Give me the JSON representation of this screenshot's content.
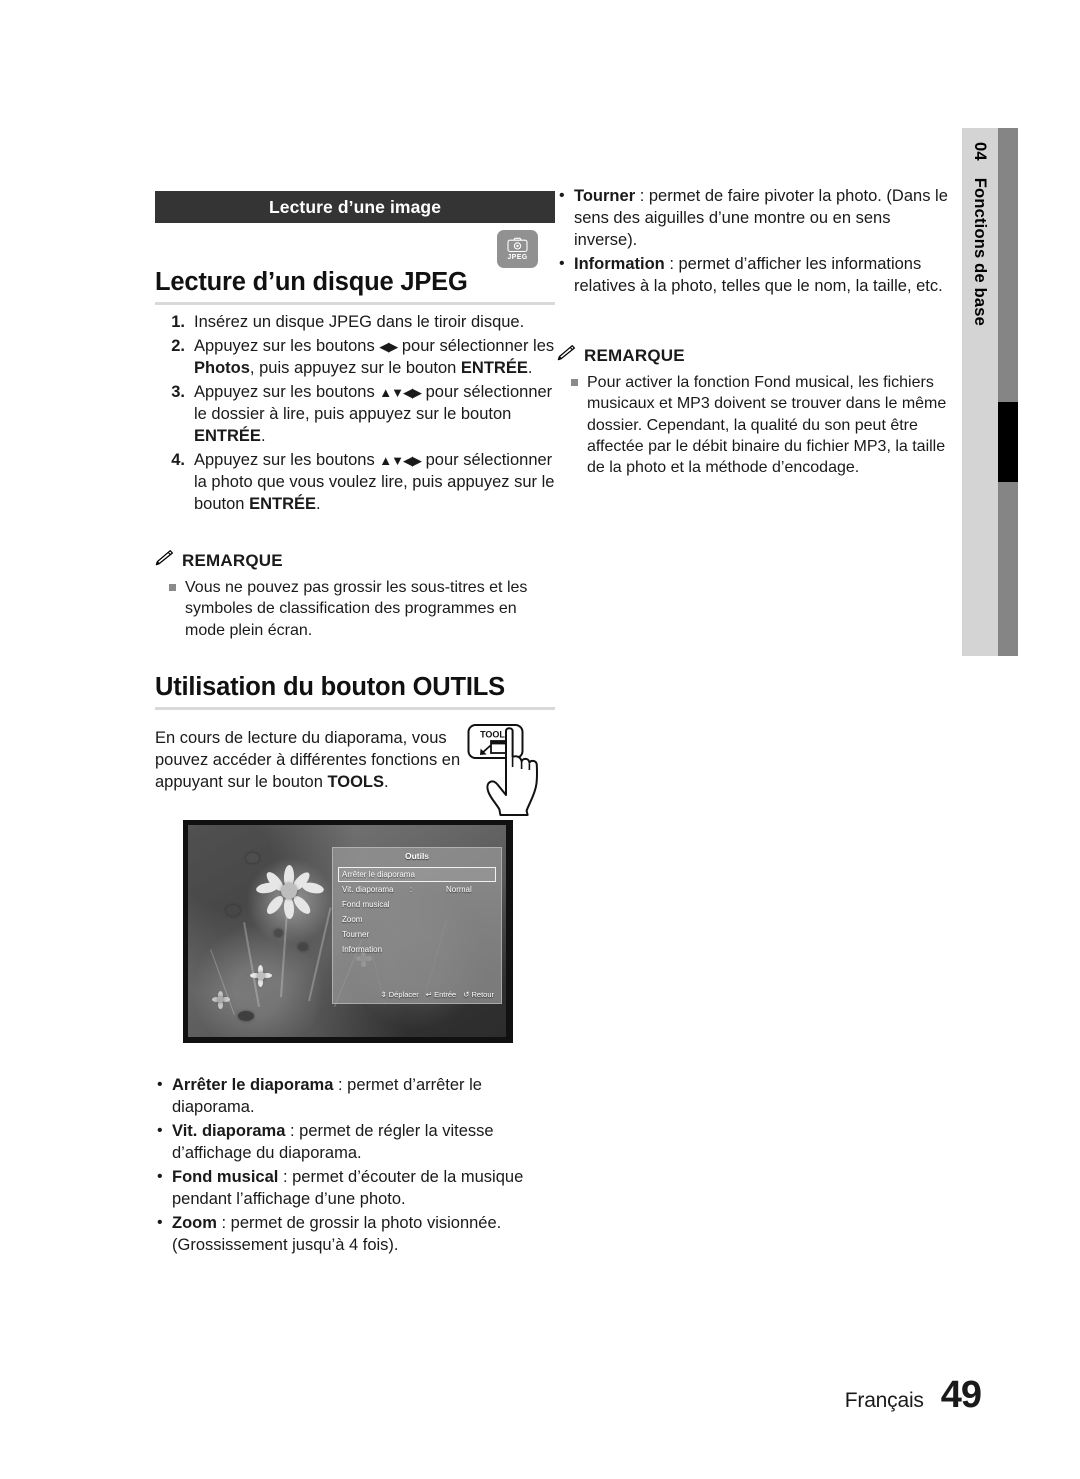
{
  "sidebar": {
    "chapter_number": "04",
    "chapter_title": "Fonctions de base"
  },
  "section_bar": {
    "label": "Lecture d’une image"
  },
  "media_badge": {
    "icon": "camera-icon",
    "label": "JPEG"
  },
  "jpeg_section": {
    "heading": "Lecture d’un disque JPEG",
    "steps": [
      {
        "num": "1.",
        "html": "Insérez un disque JPEG dans le tiroir disque."
      },
      {
        "num": "2.",
        "html": "Appuyez sur les boutons <span class=\"arr\">◀▶</span> pour sélectionner les <b>Photos</b>, puis appuyez sur le bouton <b>ENTRÉE</b>."
      },
      {
        "num": "3.",
        "html": "Appuyez sur les boutons <span class=\"arr\">▲▼◀▶</span> pour sélectionner le dossier à lire, puis appuyez sur le bouton <b>ENTRÉE</b>."
      },
      {
        "num": "4.",
        "html": "Appuyez sur les boutons <span class=\"arr\">▲▼◀▶</span> pour sélectionner la photo que vous voulez lire, puis appuyez sur le bouton <b>ENTRÉE</b>."
      }
    ],
    "note_title": "REMARQUE",
    "notes": [
      "Vous ne pouvez pas grossir les sous-titres et les symboles de classification des programmes en mode plein écran."
    ]
  },
  "tools_section": {
    "heading": "Utilisation du bouton OUTILS",
    "paragraph_html": "En cours de lecture du diaporama, vous pouvez accéder à différentes fonctions en appuyant sur le bouton <b>TOOLS</b>.",
    "button_label": "TOOLS"
  },
  "osd": {
    "title": "Outils",
    "items": [
      {
        "label": "Arrêter le diaporama",
        "separator": "",
        "value": "",
        "selected": true
      },
      {
        "label": "Vit. diaporama",
        "separator": ":",
        "value": "Normal",
        "selected": false
      },
      {
        "label": "Fond musical",
        "separator": "",
        "value": "",
        "selected": false
      },
      {
        "label": "Zoom",
        "separator": "",
        "value": "",
        "selected": false
      },
      {
        "label": "Tourner",
        "separator": "",
        "value": "",
        "selected": false
      },
      {
        "label": "Information",
        "separator": "",
        "value": "",
        "selected": false
      }
    ],
    "footer": [
      {
        "icon": "up-down-arrow-icon",
        "label": "Déplacer"
      },
      {
        "icon": "enter-icon",
        "label": "Entrée"
      },
      {
        "icon": "return-icon",
        "label": "Retour"
      }
    ]
  },
  "features_left": [
    "<b>Arrêter le diaporama</b> : permet d’arrêter le diaporama.",
    "<b>Vit. diaporama</b> : permet de régler la vitesse d’affichage du diaporama.",
    "<b>Fond musical</b> : permet d’écouter de la musique pendant l’affichage d’une photo.",
    "<b>Zoom</b> : permet de grossir la photo visionnée. (Grossissement jusqu’à 4 fois)."
  ],
  "features_right": [
    "<b>Tourner</b> : permet de faire pivoter la photo. (Dans le sens des aiguilles d’une montre ou en sens inverse).",
    "<b>Information</b> : permet d’afficher les informations relatives à la photo, telles que le nom, la taille, etc."
  ],
  "right_note": {
    "title": "REMARQUE",
    "items": [
      "Pour activer la fonction Fond musical, les fichiers musicaux et MP3 doivent se trouver dans le même dossier. Cependant, la qualité du son peut être affectée par le débit binaire du fichier MP3, la taille de la photo et la méthode d’encodage."
    ]
  },
  "footer": {
    "language": "Français",
    "page_number": "49"
  },
  "colors": {
    "section_bar_bg": "#343434",
    "badge_bg": "#919191",
    "rule": "#d9d9d9",
    "sidebar_light": "#d4d4d4",
    "sidebar_dark": "#858585",
    "sidebar_marker": "#000000",
    "bullet_square": "#8a8a8a"
  }
}
